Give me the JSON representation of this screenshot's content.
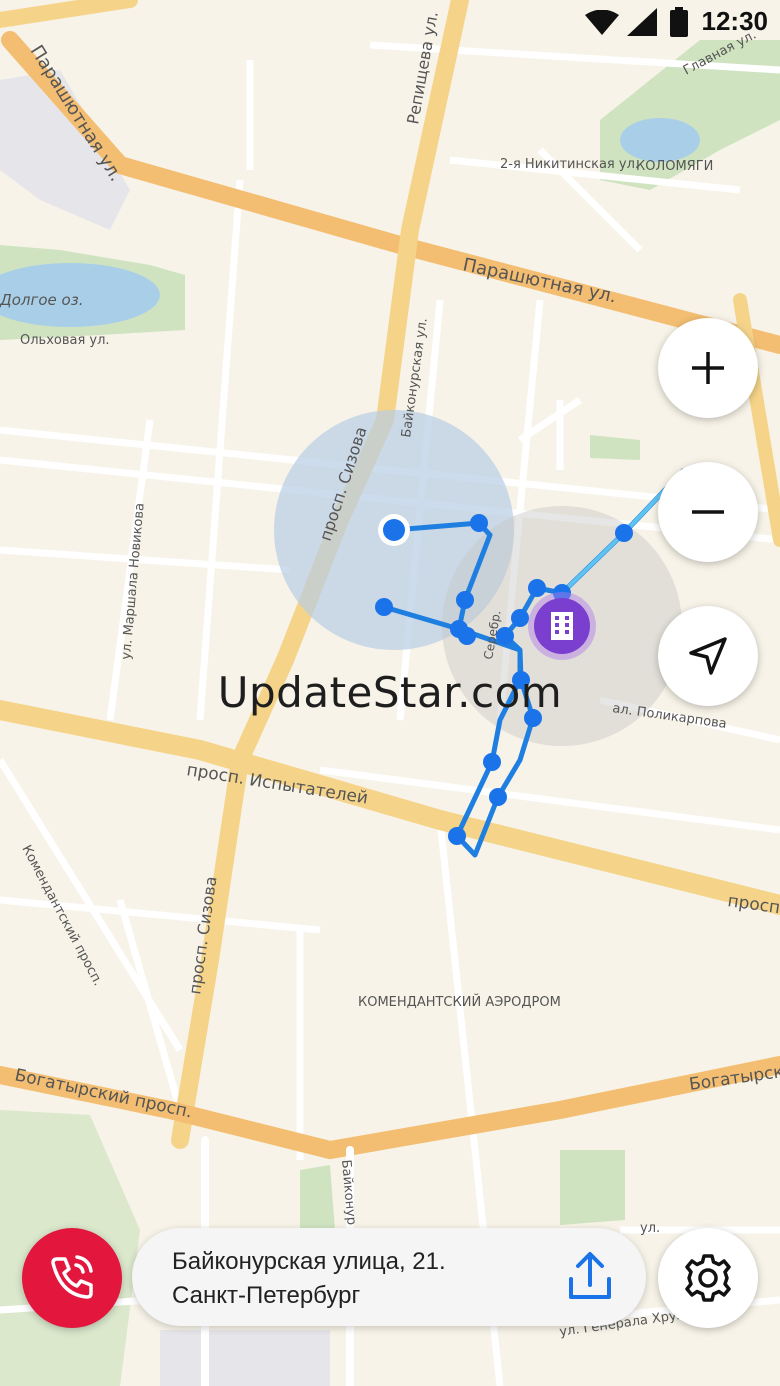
{
  "status": {
    "time": "12:30"
  },
  "map": {
    "district_labels": {
      "kolomyagi": "КОЛОМЯГИ",
      "aerodrome": "КОМЕНДАНТСКИЙ АЭРОДРОМ"
    },
    "water_label": "Долгое оз.",
    "street_labels": {
      "parashyutnaya_1": "Парашютная ул.",
      "parashyutnaya_2": "Парашютная ул.",
      "repishcheva": "Репищева ул.",
      "glavnaya": "Главная ул.",
      "nikitinskaya": "2-я Никитинская ул.",
      "olkhovaya": "Ольховая ул.",
      "baykonurskaya": "Байконурская ул.",
      "sizova_1": "просп. Сизова",
      "sizova_2": "просп. Сизова",
      "marshala_novikova": "ул. Маршала Новикова",
      "ispytateley": "просп. Испытателей",
      "ispytateley_right": "просп.",
      "polikarpova": "ал. Поликарпова",
      "serebristy": "Серебр.",
      "komendantsky": "Комендантский просп.",
      "bogatyrsky_left": "Богатырский просп.",
      "bogatyrsky_right": "Богатырск",
      "baykonurskaya_south": "Байконур",
      "khrulyova": "ул. Генерала Хрулёва",
      "bottom_ul": "ул."
    }
  },
  "controls": {
    "zoom_in": "+",
    "zoom_out": "−"
  },
  "watermark": "UpdateStar.com",
  "address": {
    "line1": "Байконурская улица, 21.",
    "line2": "Санкт-Петербург"
  },
  "colors": {
    "accent": "#1a73e8",
    "track": "#1f7fe0",
    "call": "#e3173e",
    "building_marker": "#7b3fd0"
  },
  "icons": {
    "call": "phone-ring-icon",
    "share": "share-upload-icon",
    "settings": "gear-icon",
    "locate": "navigation-arrow-icon",
    "building": "building-icon"
  }
}
